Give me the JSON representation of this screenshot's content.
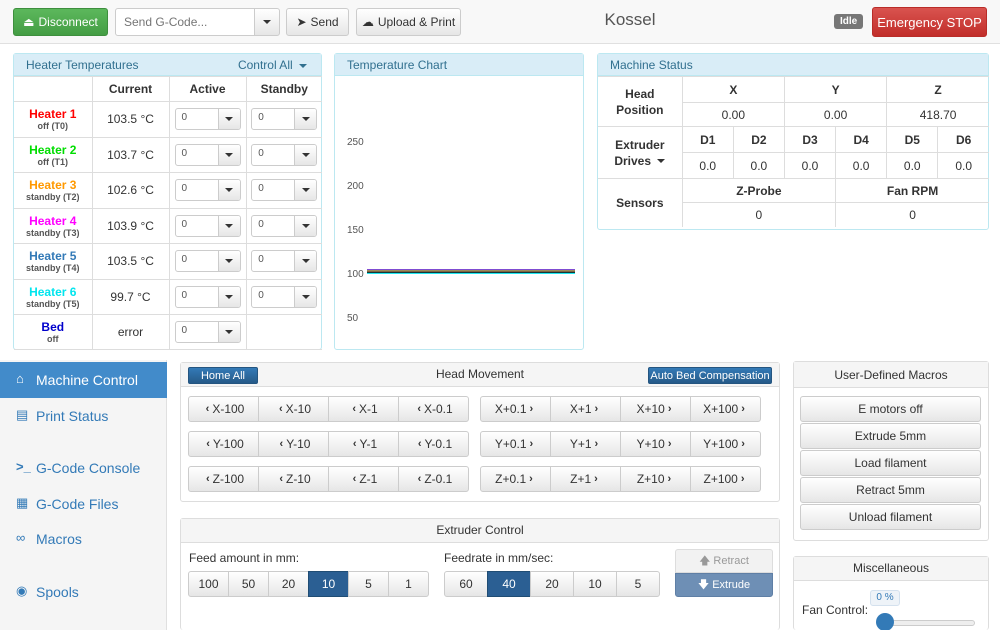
{
  "toolbar": {
    "disconnect_label": "Disconnect",
    "gcode_placeholder": "Send G-Code...",
    "send_label": "Send",
    "upload_label": "Upload & Print",
    "machine_name": "Kossel",
    "status_badge": "Idle",
    "estop_label": "Emergency STOP"
  },
  "heaters": {
    "title": "Heater Temperatures",
    "control_all": "Control All",
    "columns": [
      "Current",
      "Active",
      "Standby"
    ],
    "rows": [
      {
        "name": "Heater 1",
        "state": "off (T0)",
        "current": "103.5 °C",
        "active": "0",
        "standby": "0",
        "color": "#ff0000"
      },
      {
        "name": "Heater 2",
        "state": "off (T1)",
        "current": "103.7 °C",
        "active": "0",
        "standby": "0",
        "color": "#00dd00"
      },
      {
        "name": "Heater 3",
        "state": "standby (T2)",
        "current": "102.6 °C",
        "active": "0",
        "standby": "0",
        "color": "#ff9900"
      },
      {
        "name": "Heater 4",
        "state": "standby (T3)",
        "current": "103.9 °C",
        "active": "0",
        "standby": "0",
        "color": "#ff00ff"
      },
      {
        "name": "Heater 5",
        "state": "standby (T4)",
        "current": "103.5 °C",
        "active": "0",
        "standby": "0",
        "color": "#337ab7"
      },
      {
        "name": "Heater 6",
        "state": "standby (T5)",
        "current": "99.7 °C",
        "active": "0",
        "standby": "0",
        "color": "#00e5ee"
      }
    ],
    "bed": {
      "name": "Bed",
      "state": "off",
      "current": "error",
      "active": "0",
      "color": "#0000cc"
    }
  },
  "temp_chart": {
    "title": "Temperature Chart"
  },
  "chart_data": {
    "type": "line",
    "title": "",
    "ylim": [
      0,
      250
    ],
    "yticks": [
      0,
      50,
      100,
      150,
      200,
      250
    ],
    "series": [
      {
        "color": "#ff0000",
        "values": [
          103.5,
          103.5
        ]
      },
      {
        "color": "#00dd00",
        "values": [
          103.7,
          103.7
        ]
      },
      {
        "color": "#ff9900",
        "values": [
          102.6,
          102.6
        ]
      },
      {
        "color": "#ff00ff",
        "values": [
          103.9,
          103.9
        ]
      },
      {
        "color": "#337ab7",
        "values": [
          103.5,
          103.5
        ]
      },
      {
        "color": "#00e5ee",
        "values": [
          99.7,
          99.7
        ]
      },
      {
        "color": "#000000",
        "values": [
          101,
          101
        ]
      }
    ]
  },
  "machine_status": {
    "title": "Machine Status",
    "head_label_1": "Head",
    "head_label_2": "Position",
    "axes": [
      {
        "name": "X",
        "value": "0.00"
      },
      {
        "name": "Y",
        "value": "0.00"
      },
      {
        "name": "Z",
        "value": "418.70"
      }
    ],
    "extruder_label_1": "Extruder",
    "extruder_label_2": "Drives",
    "drives": [
      {
        "name": "D1",
        "value": "0.0"
      },
      {
        "name": "D2",
        "value": "0.0"
      },
      {
        "name": "D3",
        "value": "0.0"
      },
      {
        "name": "D4",
        "value": "0.0"
      },
      {
        "name": "D5",
        "value": "0.0"
      },
      {
        "name": "D6",
        "value": "0.0"
      }
    ],
    "sensors_label": "Sensors",
    "zprobe_label": "Z-Probe",
    "zprobe_value": "0",
    "fan_label": "Fan RPM",
    "fan_value": "0"
  },
  "sidebar": {
    "items": [
      {
        "label": "Machine Control",
        "icon": "home-icon"
      },
      {
        "label": "Print Status",
        "icon": "print-icon"
      },
      {
        "label": "G-Code Console",
        "icon": "terminal-icon"
      },
      {
        "label": "G-Code Files",
        "icon": "files-icon"
      },
      {
        "label": "Macros",
        "icon": "link-icon"
      },
      {
        "label": "Spools",
        "icon": "spool-icon"
      }
    ]
  },
  "head_movement": {
    "title": "Head Movement",
    "home_all": "Home All",
    "auto_bed": "Auto Bed Compensation",
    "x_neg": [
      "X-100",
      "X-10",
      "X-1",
      "X-0.1"
    ],
    "x_pos": [
      "X+0.1",
      "X+1",
      "X+10",
      "X+100"
    ],
    "y_neg": [
      "Y-100",
      "Y-10",
      "Y-1",
      "Y-0.1"
    ],
    "y_pos": [
      "Y+0.1",
      "Y+1",
      "Y+10",
      "Y+100"
    ],
    "z_neg": [
      "Z-100",
      "Z-10",
      "Z-1",
      "Z-0.1"
    ],
    "z_pos": [
      "Z+0.1",
      "Z+1",
      "Z+10",
      "Z+100"
    ]
  },
  "extruder": {
    "title": "Extruder Control",
    "feed_label": "Feed amount in mm:",
    "feed_values": [
      "100",
      "50",
      "20",
      "10",
      "5",
      "1"
    ],
    "feed_selected": 3,
    "rate_label": "Feedrate in mm/sec:",
    "rate_values": [
      "60",
      "40",
      "20",
      "10",
      "5"
    ],
    "rate_selected": 1,
    "retract_label": "Retract",
    "extrude_label": "Extrude"
  },
  "macros": {
    "title": "User-Defined Macros",
    "items": [
      "E motors off",
      "Extrude 5mm",
      "Load filament",
      "Retract 5mm",
      "Unload filament"
    ]
  },
  "misc": {
    "title": "Miscellaneous",
    "fan_label": "Fan Control:",
    "fan_value": "0 %"
  }
}
